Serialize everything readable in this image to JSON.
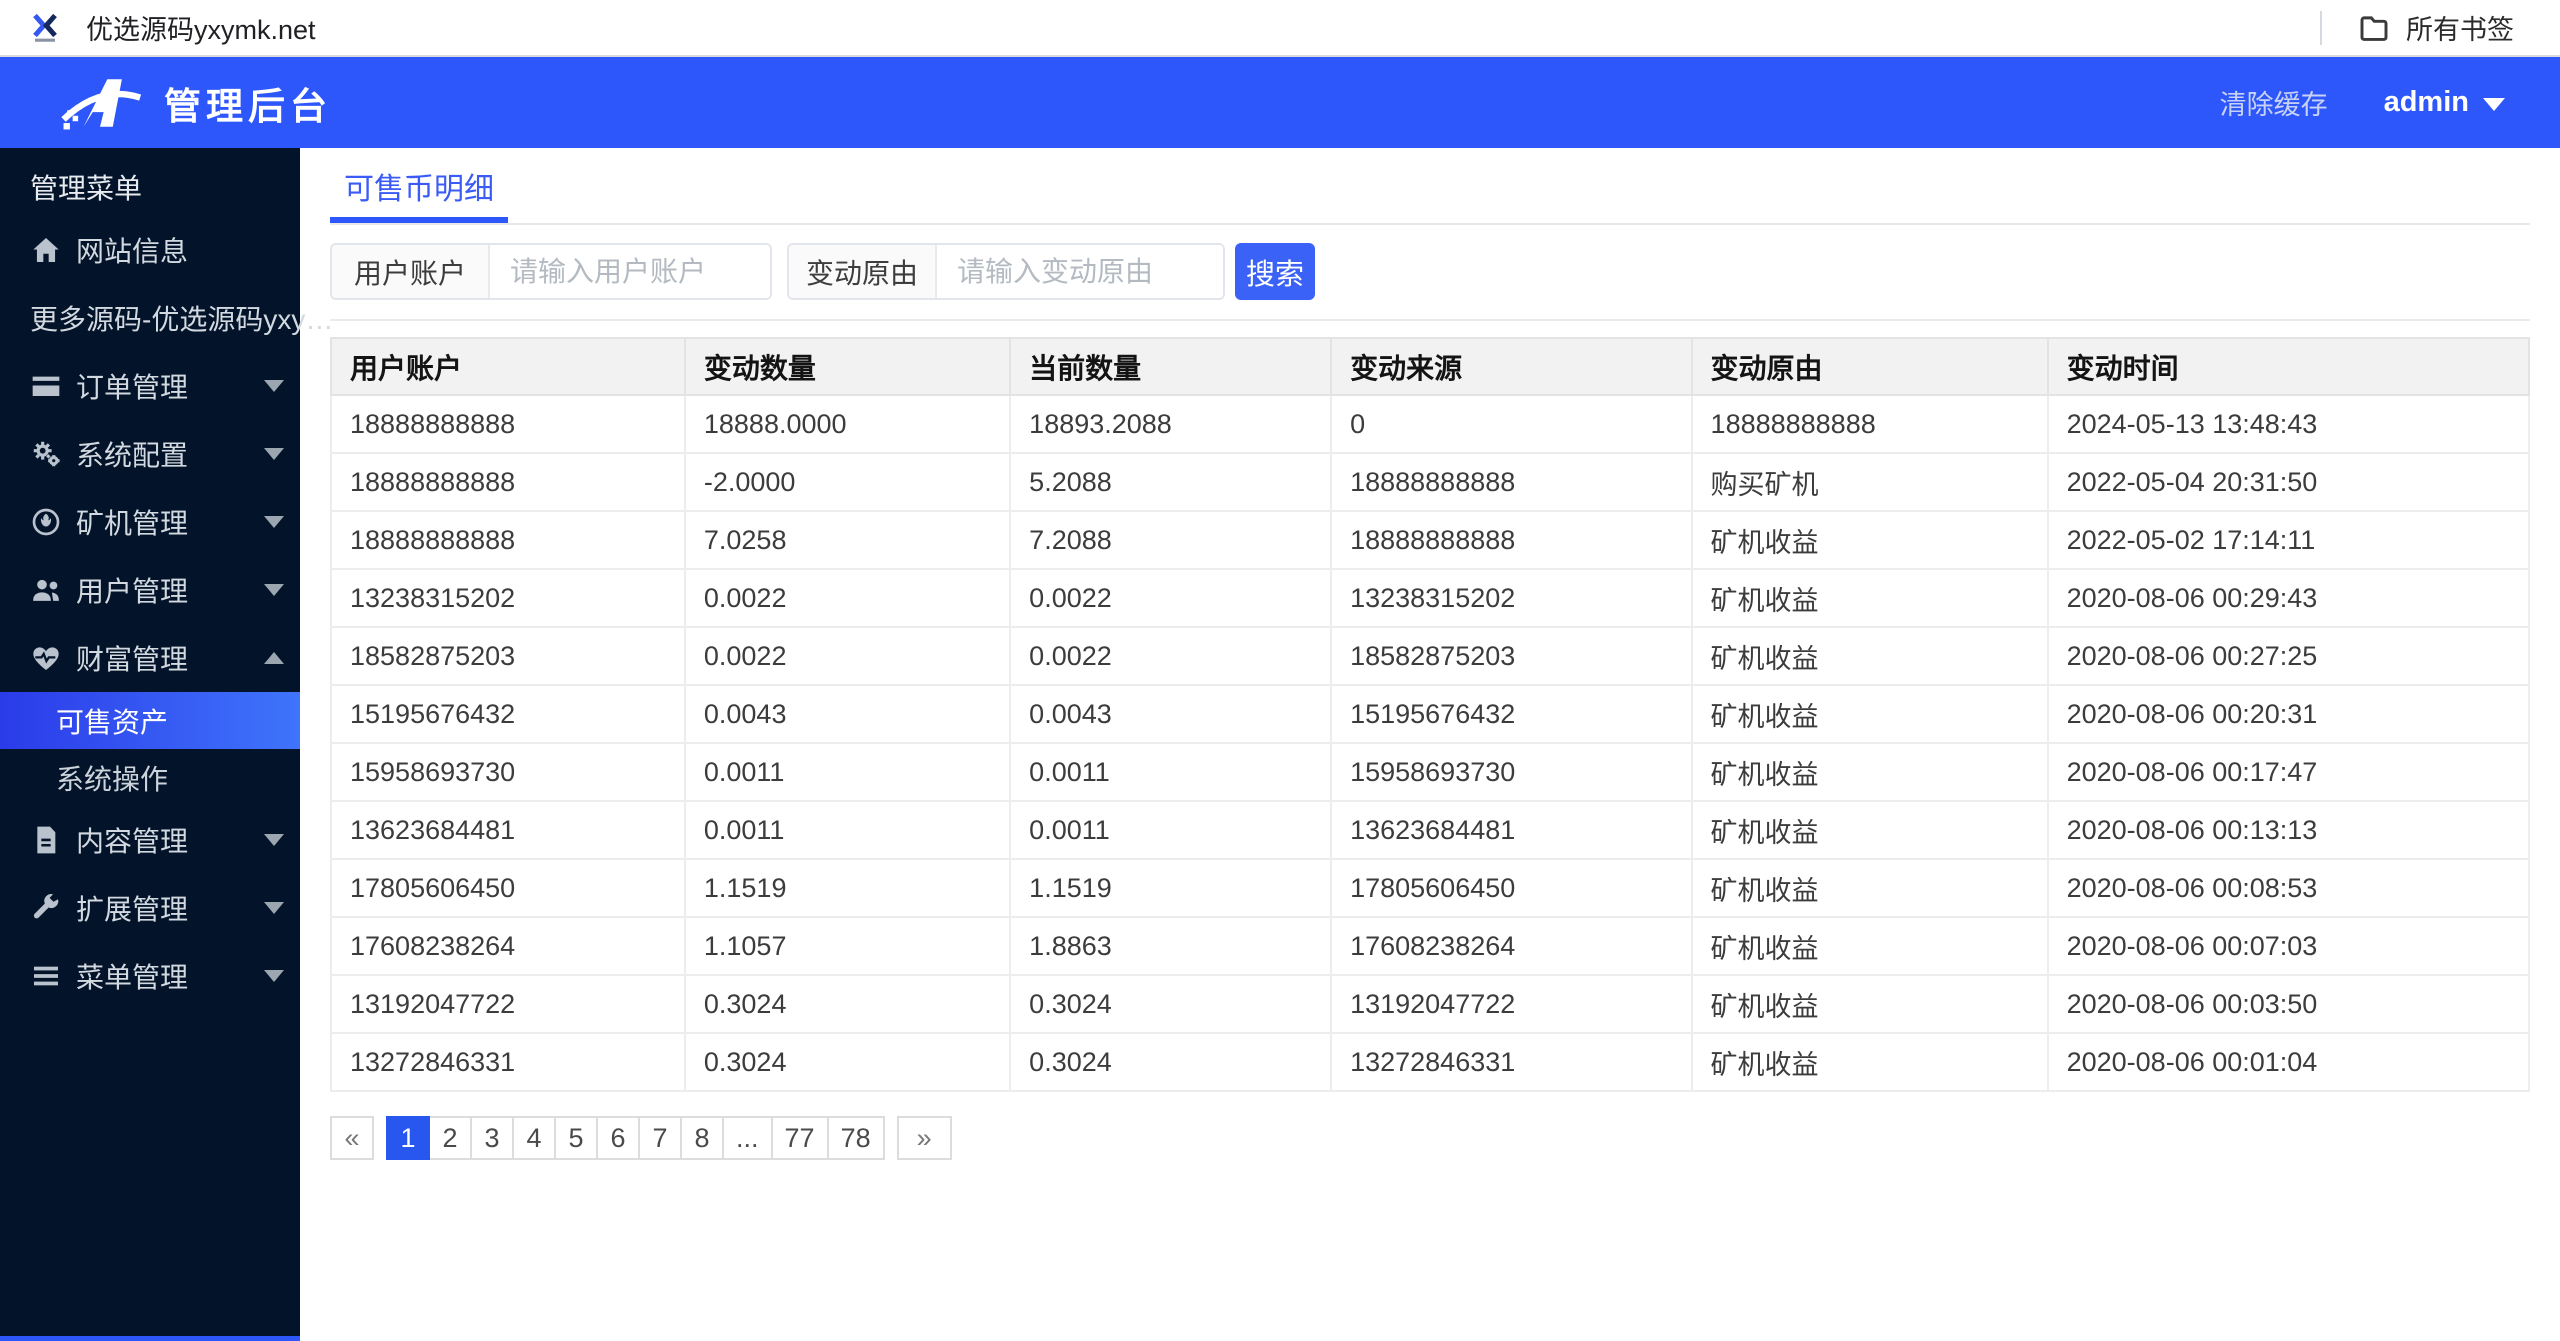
{
  "browser": {
    "tab_title": "优选源码yxymk.net",
    "bookmarks_label": "所有书签"
  },
  "header": {
    "app_title": "管理后台",
    "clear_cache_label": "清除缓存",
    "username": "admin"
  },
  "sidebar": {
    "section_label": "管理菜单",
    "items": [
      {
        "label": "网站信息",
        "icon": "home",
        "caret": null
      },
      {
        "label": "更多源码-优选源码yxy…",
        "icon": null,
        "caret": null
      },
      {
        "label": "订单管理",
        "icon": "credit-card",
        "caret": "down"
      },
      {
        "label": "系统配置",
        "icon": "cogs",
        "caret": "down"
      },
      {
        "label": "矿机管理",
        "icon": "rebel",
        "caret": "down"
      },
      {
        "label": "用户管理",
        "icon": "users",
        "caret": "down"
      },
      {
        "label": "财富管理",
        "icon": "heartbeat",
        "caret": "up",
        "children": [
          {
            "label": "可售资产",
            "active": true
          },
          {
            "label": "系统操作",
            "active": false
          }
        ]
      },
      {
        "label": "内容管理",
        "icon": "file",
        "caret": "down"
      },
      {
        "label": "扩展管理",
        "icon": "wrench",
        "caret": "down"
      },
      {
        "label": "菜单管理",
        "icon": "bars",
        "caret": "down"
      }
    ]
  },
  "main": {
    "tab": "可售币明细",
    "search": {
      "field1_label": "用户账户",
      "field1_placeholder": "请输入用户账户",
      "field1_value": "",
      "field2_label": "变动原由",
      "field2_placeholder": "请输入变动原由",
      "field2_value": "",
      "button_label": "搜索"
    },
    "table": {
      "columns": [
        "用户账户",
        "变动数量",
        "当前数量",
        "变动来源",
        "变动原由",
        "变动时间"
      ],
      "col_widths_pct": [
        16.1,
        14.8,
        14.6,
        16.4,
        16.2,
        21.9
      ],
      "rows": [
        [
          "18888888888",
          "18888.0000",
          "18893.2088",
          "0",
          "18888888888",
          "2024-05-13 13:48:43"
        ],
        [
          "18888888888",
          "-2.0000",
          "5.2088",
          "18888888888",
          "购买矿机",
          "2022-05-04 20:31:50"
        ],
        [
          "18888888888",
          "7.0258",
          "7.2088",
          "18888888888",
          "矿机收益",
          "2022-05-02 17:14:11"
        ],
        [
          "13238315202",
          "0.0022",
          "0.0022",
          "13238315202",
          "矿机收益",
          "2020-08-06 00:29:43"
        ],
        [
          "18582875203",
          "0.0022",
          "0.0022",
          "18582875203",
          "矿机收益",
          "2020-08-06 00:27:25"
        ],
        [
          "15195676432",
          "0.0043",
          "0.0043",
          "15195676432",
          "矿机收益",
          "2020-08-06 00:20:31"
        ],
        [
          "15958693730",
          "0.0011",
          "0.0011",
          "15958693730",
          "矿机收益",
          "2020-08-06 00:17:47"
        ],
        [
          "13623684481",
          "0.0011",
          "0.0011",
          "13623684481",
          "矿机收益",
          "2020-08-06 00:13:13"
        ],
        [
          "17805606450",
          "1.1519",
          "1.1519",
          "17805606450",
          "矿机收益",
          "2020-08-06 00:08:53"
        ],
        [
          "17608238264",
          "1.1057",
          "1.8863",
          "17608238264",
          "矿机收益",
          "2020-08-06 00:07:03"
        ],
        [
          "13192047722",
          "0.3024",
          "0.3024",
          "13192047722",
          "矿机收益",
          "2020-08-06 00:03:50"
        ],
        [
          "13272846331",
          "0.3024",
          "0.3024",
          "13272846331",
          "矿机收益",
          "2020-08-06 00:01:04"
        ]
      ]
    },
    "pagination": {
      "prev": "«",
      "next": "»",
      "pages": [
        "1",
        "2",
        "3",
        "4",
        "5",
        "6",
        "7",
        "8",
        "...",
        "77",
        "78"
      ],
      "active": "1"
    }
  },
  "colors": {
    "accent": "#2e57fb",
    "sidebar_bg": "#03142a",
    "active_item_gradient_left": "#2b3be9",
    "active_item_gradient_right": "#3f74fb",
    "table_header_bg": "#f2f2f2",
    "pagination_active": "#2857f0"
  }
}
